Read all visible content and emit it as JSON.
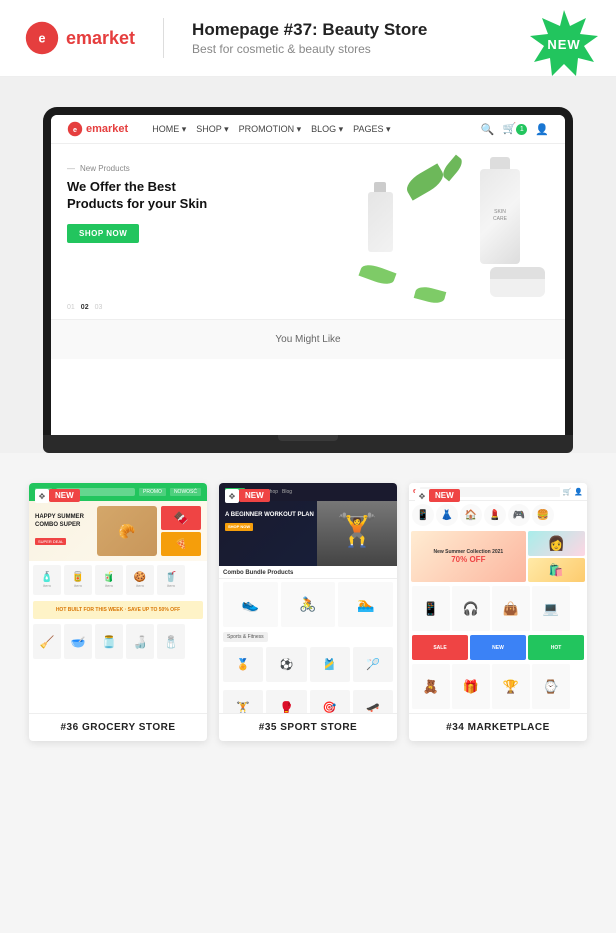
{
  "header": {
    "logo_text": "emarket",
    "title": "Homepage #37: Beauty Store",
    "subtitle": "Best for cosmetic & beauty stores",
    "new_badge": "NEW"
  },
  "store_preview": {
    "nav": {
      "logo": "emarket",
      "links": [
        "HOME",
        "SHOP",
        "PROMOTION",
        "BLOG",
        "PAGES"
      ],
      "cart_count": "1"
    },
    "hero": {
      "new_label": "New Products",
      "title_line1": "We Offer the Best",
      "title_line2": "Products for your Skin",
      "shop_button": "SHOP NOW"
    },
    "dots": [
      "01",
      "02",
      "03"
    ],
    "you_might_like": "You Might Like"
  },
  "store_cards": [
    {
      "id": "grocery",
      "number": "#36",
      "label": "#36 GROCERY STORE",
      "new_badge": "NEW",
      "hero_title": "HAPPY SUMMER COMBO SUPER",
      "banner_text": "HOT BUILT FOR THIS WEEK · SAVE UP TO 50% OFF"
    },
    {
      "id": "sport",
      "number": "#35",
      "label": "#35 SPORT STORE",
      "new_badge": "NEW",
      "hero_title": "A BEGINNER WORKOUT PLAN",
      "section_title": "Combo Bundle Products",
      "cat_label": "Sports & Fitness"
    },
    {
      "id": "marketplace",
      "number": "#34",
      "label": "#34 MARKETPLACE",
      "new_badge": "NEW",
      "hero_title": "New Summer Collection 2021",
      "hero_discount": "70% OFF"
    }
  ]
}
